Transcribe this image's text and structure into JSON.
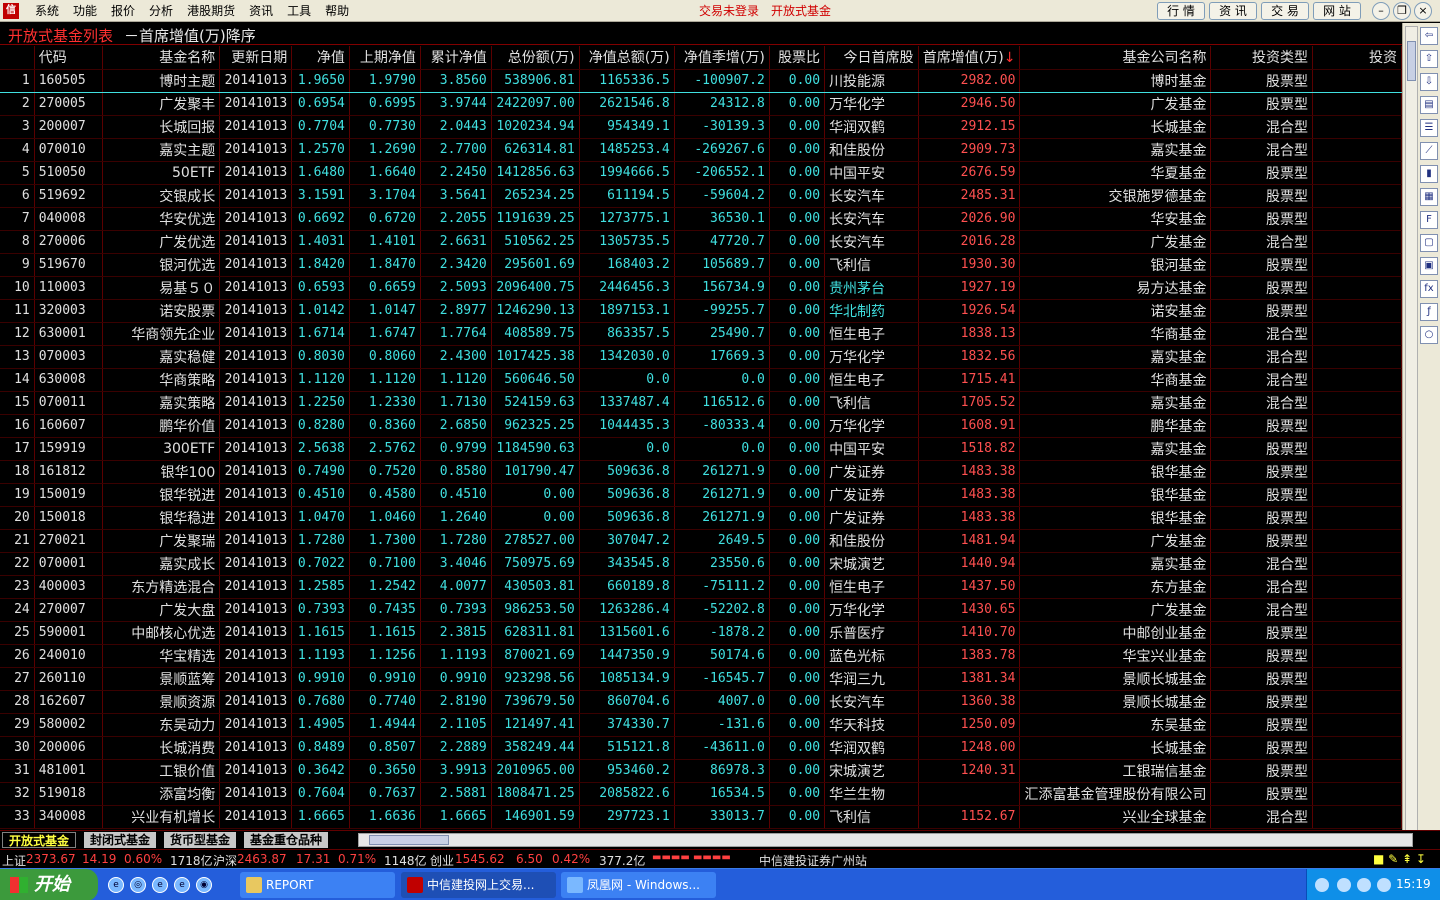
{
  "menu": [
    "系统",
    "功能",
    "报价",
    "分析",
    "港股期货",
    "资讯",
    "工具",
    "帮助"
  ],
  "center_links": [
    "交易未登录",
    "开放式基金"
  ],
  "right_buttons": [
    "行 情",
    "资 讯",
    "交 易",
    "网 站"
  ],
  "title": {
    "main": "开放式基金列表",
    "sub": "－首席增值(万)降序"
  },
  "columns": [
    "代码",
    "基金名称",
    "更新日期",
    "净值",
    "上期净值",
    "累计净值",
    "总份额(万)",
    "净值总额(万)",
    "净值季增(万)",
    "股票比",
    "今日首席股",
    "首席增值(万)",
    "基金公司名称",
    "投资类型",
    "投资"
  ],
  "sort_arrow": "↓",
  "rows": [
    [
      "1",
      "160505",
      "博时主题",
      "20141013",
      "1.9650",
      "1.9790",
      "3.8560",
      "538906.81",
      "1165336.5",
      "-100907.2",
      "0.00",
      "川投能源",
      "2982.00",
      "博时基金",
      "股票型"
    ],
    [
      "2",
      "270005",
      "广发聚丰",
      "20141013",
      "0.6954",
      "0.6995",
      "3.9744",
      "2422097.00",
      "2621546.8",
      "24312.8",
      "0.00",
      "万华化学",
      "2946.50",
      "广发基金",
      "股票型"
    ],
    [
      "3",
      "200007",
      "长城回报",
      "20141013",
      "0.7704",
      "0.7730",
      "2.0443",
      "1020234.94",
      "954349.1",
      "-30139.3",
      "0.00",
      "华润双鹤",
      "2912.15",
      "长城基金",
      "混合型"
    ],
    [
      "4",
      "070010",
      "嘉实主题",
      "20141013",
      "1.2570",
      "1.2690",
      "2.7700",
      "626314.81",
      "1485253.4",
      "-269267.6",
      "0.00",
      "和佳股份",
      "2909.73",
      "嘉实基金",
      "混合型"
    ],
    [
      "5",
      "510050",
      "50ETF",
      "20141013",
      "1.6480",
      "1.6640",
      "2.2450",
      "1412856.63",
      "1994666.5",
      "-206552.1",
      "0.00",
      "中国平安",
      "2676.59",
      "华夏基金",
      "股票型"
    ],
    [
      "6",
      "519692",
      "交银成长",
      "20141013",
      "3.1591",
      "3.1704",
      "3.5641",
      "265234.25",
      "611194.5",
      "-59604.2",
      "0.00",
      "长安汽车",
      "2485.31",
      "交银施罗德基金",
      "股票型"
    ],
    [
      "7",
      "040008",
      "华安优选",
      "20141013",
      "0.6692",
      "0.6720",
      "2.2055",
      "1191639.25",
      "1273775.1",
      "36530.1",
      "0.00",
      "长安汽车",
      "2026.90",
      "华安基金",
      "股票型"
    ],
    [
      "8",
      "270006",
      "广发优选",
      "20141013",
      "1.4031",
      "1.4101",
      "2.6631",
      "510562.25",
      "1305735.5",
      "47720.7",
      "0.00",
      "长安汽车",
      "2016.28",
      "广发基金",
      "混合型"
    ],
    [
      "9",
      "519670",
      "银河优选",
      "20141013",
      "1.8420",
      "1.8470",
      "2.3420",
      "295601.69",
      "168403.2",
      "105689.7",
      "0.00",
      "飞利信",
      "1930.30",
      "银河基金",
      "股票型"
    ],
    [
      "10",
      "110003",
      "易基５０",
      "20141013",
      "0.6593",
      "0.6659",
      "2.5093",
      "2096400.75",
      "2446456.3",
      "156734.9",
      "0.00",
      "贵州茅台",
      "1927.19",
      "易方达基金",
      "股票型"
    ],
    [
      "11",
      "320003",
      "诺安股票",
      "20141013",
      "1.0142",
      "1.0147",
      "2.8977",
      "1246290.13",
      "1897153.1",
      "-99255.7",
      "0.00",
      "华北制药",
      "1926.54",
      "诺安基金",
      "股票型"
    ],
    [
      "12",
      "630001",
      "华商领先企业",
      "20141013",
      "1.6714",
      "1.6747",
      "1.7764",
      "408589.75",
      "863357.5",
      "25490.7",
      "0.00",
      "恒生电子",
      "1838.13",
      "华商基金",
      "混合型"
    ],
    [
      "13",
      "070003",
      "嘉实稳健",
      "20141013",
      "0.8030",
      "0.8060",
      "2.4300",
      "1017425.38",
      "1342030.0",
      "17669.3",
      "0.00",
      "万华化学",
      "1832.56",
      "嘉实基金",
      "混合型"
    ],
    [
      "14",
      "630008",
      "华商策略",
      "20141013",
      "1.1120",
      "1.1120",
      "1.1120",
      "560646.50",
      "0.0",
      "0.0",
      "0.00",
      "恒生电子",
      "1715.41",
      "华商基金",
      "混合型"
    ],
    [
      "15",
      "070011",
      "嘉实策略",
      "20141013",
      "1.2250",
      "1.2330",
      "1.7130",
      "524159.63",
      "1337487.4",
      "116512.6",
      "0.00",
      "飞利信",
      "1705.52",
      "嘉实基金",
      "混合型"
    ],
    [
      "16",
      "160607",
      "鹏华价值",
      "20141013",
      "0.8280",
      "0.8360",
      "2.6850",
      "962325.25",
      "1044435.3",
      "-80333.4",
      "0.00",
      "万华化学",
      "1608.91",
      "鹏华基金",
      "股票型"
    ],
    [
      "17",
      "159919",
      "300ETF",
      "20141013",
      "2.5638",
      "2.5762",
      "0.9799",
      "1184590.63",
      "0.0",
      "0.0",
      "0.00",
      "中国平安",
      "1518.82",
      "嘉实基金",
      "股票型"
    ],
    [
      "18",
      "161812",
      "银华100",
      "20141013",
      "0.7490",
      "0.7520",
      "0.8580",
      "101790.47",
      "509636.8",
      "261271.9",
      "0.00",
      "广发证券",
      "1483.38",
      "银华基金",
      "股票型"
    ],
    [
      "19",
      "150019",
      "银华锐进",
      "20141013",
      "0.4510",
      "0.4580",
      "0.4510",
      "0.00",
      "509636.8",
      "261271.9",
      "0.00",
      "广发证券",
      "1483.38",
      "银华基金",
      "股票型"
    ],
    [
      "20",
      "150018",
      "银华稳进",
      "20141013",
      "1.0470",
      "1.0460",
      "1.2640",
      "0.00",
      "509636.8",
      "261271.9",
      "0.00",
      "广发证券",
      "1483.38",
      "银华基金",
      "股票型"
    ],
    [
      "21",
      "270021",
      "广发聚瑞",
      "20141013",
      "1.7280",
      "1.7300",
      "1.7280",
      "278527.00",
      "307047.2",
      "2649.5",
      "0.00",
      "和佳股份",
      "1481.94",
      "广发基金",
      "股票型"
    ],
    [
      "22",
      "070001",
      "嘉实成长",
      "20141013",
      "0.7022",
      "0.7100",
      "3.4046",
      "750975.69",
      "343545.8",
      "23550.6",
      "0.00",
      "宋城演艺",
      "1440.94",
      "嘉实基金",
      "混合型"
    ],
    [
      "23",
      "400003",
      "东方精选混合",
      "20141013",
      "1.2585",
      "1.2542",
      "4.0077",
      "430503.81",
      "660189.8",
      "-75111.2",
      "0.00",
      "恒生电子",
      "1437.50",
      "东方基金",
      "混合型"
    ],
    [
      "24",
      "270007",
      "广发大盘",
      "20141013",
      "0.7393",
      "0.7435",
      "0.7393",
      "986253.50",
      "1263286.4",
      "-52202.8",
      "0.00",
      "万华化学",
      "1430.65",
      "广发基金",
      "混合型"
    ],
    [
      "25",
      "590001",
      "中邮核心优选",
      "20141013",
      "1.1615",
      "1.1615",
      "2.3815",
      "628311.81",
      "1315601.6",
      "-1878.2",
      "0.00",
      "乐普医疗",
      "1410.70",
      "中邮创业基金",
      "股票型"
    ],
    [
      "26",
      "240010",
      "华宝精选",
      "20141013",
      "1.1193",
      "1.1256",
      "1.1193",
      "870021.69",
      "1447350.9",
      "50174.6",
      "0.00",
      "蓝色光标",
      "1383.78",
      "华宝兴业基金",
      "股票型"
    ],
    [
      "27",
      "260110",
      "景顺蓝筹",
      "20141013",
      "0.9910",
      "0.9910",
      "0.9910",
      "923298.56",
      "1085134.9",
      "-16545.7",
      "0.00",
      "华润三九",
      "1381.34",
      "景顺长城基金",
      "股票型"
    ],
    [
      "28",
      "162607",
      "景顺资源",
      "20141013",
      "0.7680",
      "0.7740",
      "2.8190",
      "739679.50",
      "860704.6",
      "4007.0",
      "0.00",
      "长安汽车",
      "1360.38",
      "景顺长城基金",
      "股票型"
    ],
    [
      "29",
      "580002",
      "东吴动力",
      "20141013",
      "1.4905",
      "1.4944",
      "2.1105",
      "121497.41",
      "374330.7",
      "-131.6",
      "0.00",
      "华天科技",
      "1250.09",
      "东吴基金",
      "股票型"
    ],
    [
      "30",
      "200006",
      "长城消费",
      "20141013",
      "0.8489",
      "0.8507",
      "2.2889",
      "358249.44",
      "515121.8",
      "-43611.0",
      "0.00",
      "华润双鹤",
      "1248.00",
      "长城基金",
      "股票型"
    ],
    [
      "31",
      "481001",
      "工银价值",
      "20141013",
      "0.3642",
      "0.3650",
      "3.9913",
      "2010965.00",
      "953460.2",
      "86978.3",
      "0.00",
      "宋城演艺",
      "1240.31",
      "工银瑞信基金",
      "股票型"
    ],
    [
      "32",
      "519018",
      "添富均衡",
      "20141013",
      "0.7604",
      "0.7637",
      "2.5881",
      "1808471.25",
      "2085822.6",
      "16534.5",
      "0.00",
      "华兰生物",
      "",
      "汇添富基金管理股份有限公司",
      "股票型"
    ],
    [
      "33",
      "340008",
      "兴业有机增长",
      "20141013",
      "1.6665",
      "1.6636",
      "1.6665",
      "146901.59",
      "297723.1",
      "33013.7",
      "0.00",
      "飞利信",
      "1152.67",
      "兴业全球基金",
      "混合型"
    ]
  ],
  "highlight_stock_rows": [
    10,
    11
  ],
  "tabs": [
    "开放式基金",
    "封闭式基金",
    "货币型基金",
    "基金重仓品种"
  ],
  "status": {
    "sh_label": "上证",
    "sh_val": "2373.67",
    "sh_chg": "14.19",
    "sh_pct": "0.60%",
    "sh_amt": "1718亿",
    "hs_label": "沪深",
    "hs_val": "2463.87",
    "hs_chg": "17.31",
    "hs_pct": "0.71%",
    "hs_amt": "1148亿",
    "cy_label": "创业",
    "cy_val": "1545.62",
    "cy_chg": "6.50",
    "cy_pct": "0.42%",
    "cy_amt": "377.2亿",
    "station": "中信建投证券广州站"
  },
  "taskbar": {
    "start": "开始",
    "buttons": [
      "REPORT",
      "中信建投网上交易...",
      "凤凰网 - Windows..."
    ],
    "clock": "15:19"
  },
  "colors": {
    "up": "#ff4040",
    "cyan": "#40e0e0",
    "grid_line": "#5a0000",
    "accent_red": "#d00000"
  }
}
